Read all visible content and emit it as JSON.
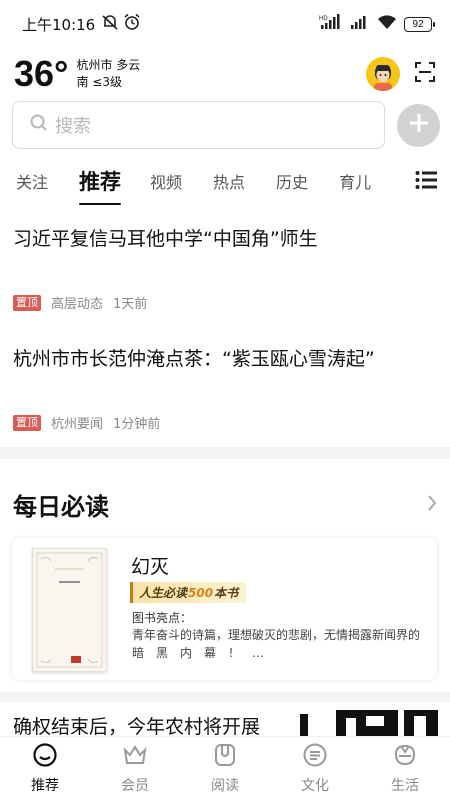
{
  "status_bar": {
    "time": "上午10:16",
    "battery": "92",
    "icons": [
      "mute-icon",
      "alarm-icon",
      "hd-signal-icon",
      "signal-icon",
      "wifi-icon",
      "battery-icon"
    ]
  },
  "weather": {
    "temperature": "36°",
    "city_condition": "杭州市 多云",
    "wind": "南 ≤3级"
  },
  "search": {
    "placeholder": "搜索"
  },
  "tabs": [
    {
      "label": "关注",
      "active": false
    },
    {
      "label": "推荐",
      "active": true
    },
    {
      "label": "视频",
      "active": false
    },
    {
      "label": "热点",
      "active": false
    },
    {
      "label": "历史",
      "active": false
    },
    {
      "label": "育儿",
      "active": false
    }
  ],
  "news": [
    {
      "title": "习近平复信马耳他中学“中国角”师生",
      "badge": "置顶",
      "source": "高层动态",
      "time": "1天前"
    },
    {
      "title": "杭州市市长范仲淹点茶：“紫玉瓯心雪涛起”",
      "badge": "置顶",
      "source": "杭州要闻",
      "time": "1分钟前"
    }
  ],
  "daily": {
    "section_title": "每日必读",
    "book": {
      "title": "幻灭",
      "badge_prefix": "人生必读",
      "badge_number": "500",
      "badge_suffix": "本书",
      "label": "图书亮点：",
      "description": "青年奋斗的诗篇，理想破灭的悲剧，无情揭露新闻界的　暗　黑　内　幕　！　…"
    }
  },
  "peek_news": {
    "title": "确权结束后，今年农村将开展"
  },
  "bottom_nav": [
    {
      "label": "推荐",
      "icon": "recommend-icon",
      "active": true
    },
    {
      "label": "会员",
      "icon": "crown-icon",
      "active": false
    },
    {
      "label": "阅读",
      "icon": "book-icon",
      "active": false
    },
    {
      "label": "文化",
      "icon": "culture-icon",
      "active": false
    },
    {
      "label": "生活",
      "icon": "life-icon",
      "active": false
    }
  ],
  "colors": {
    "pin_badge": "#d65c54",
    "avatar_bg": "#f5c61a",
    "badge_accent": "#d8831e"
  }
}
